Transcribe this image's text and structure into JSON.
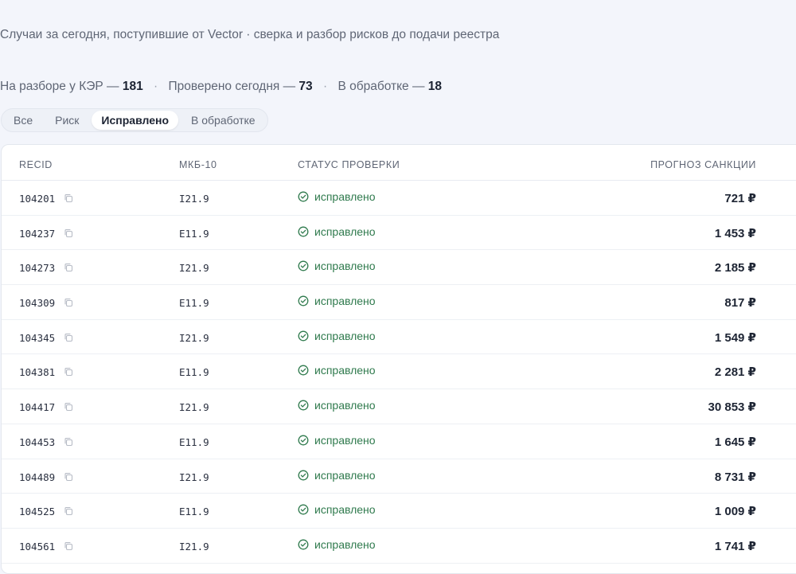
{
  "header": {
    "subtitle": "Случаи за сегодня, поступившие от Vector · сверка и разбор рисков до подачи реестра"
  },
  "stats": [
    {
      "label": "На разборе у КЭР —",
      "value": "181"
    },
    {
      "label": "Проверено сегодня —",
      "value": "73"
    },
    {
      "label": "В обработке —",
      "value": "18"
    }
  ],
  "stats_separator": "·",
  "tabs": [
    {
      "label": "Все"
    },
    {
      "label": "Риск"
    },
    {
      "label": "Исправлено"
    },
    {
      "label": "В обработке"
    }
  ],
  "active_tab": "Исправлено",
  "table": {
    "columns": {
      "recid": "RECID",
      "mkb": "МКБ-10",
      "status": "СТАТУС ПРОВЕРКИ",
      "sanction": "ПРОГНОЗ САНКЦИИ"
    },
    "rows": [
      {
        "recid": "104201",
        "mkb": "I21.9",
        "status": "исправлено",
        "sanction": "721 ₽"
      },
      {
        "recid": "104237",
        "mkb": "E11.9",
        "status": "исправлено",
        "sanction": "1 453 ₽"
      },
      {
        "recid": "104273",
        "mkb": "I21.9",
        "status": "исправлено",
        "sanction": "2 185 ₽"
      },
      {
        "recid": "104309",
        "mkb": "E11.9",
        "status": "исправлено",
        "sanction": "817 ₽"
      },
      {
        "recid": "104345",
        "mkb": "I21.9",
        "status": "исправлено",
        "sanction": "1 549 ₽"
      },
      {
        "recid": "104381",
        "mkb": "E11.9",
        "status": "исправлено",
        "sanction": "2 281 ₽"
      },
      {
        "recid": "104417",
        "mkb": "I21.9",
        "status": "исправлено",
        "sanction": "30 853 ₽"
      },
      {
        "recid": "104453",
        "mkb": "E11.9",
        "status": "исправлено",
        "sanction": "1 645 ₽"
      },
      {
        "recid": "104489",
        "mkb": "I21.9",
        "status": "исправлено",
        "sanction": "8 731 ₽"
      },
      {
        "recid": "104525",
        "mkb": "E11.9",
        "status": "исправлено",
        "sanction": "1 009 ₽"
      },
      {
        "recid": "104561",
        "mkb": "I21.9",
        "status": "исправлено",
        "sanction": "1 741 ₽"
      }
    ]
  },
  "icons": {
    "copy": "copy-icon",
    "status_ok": "check-circle-icon"
  },
  "colors": {
    "status_ok": "#2f7a4d",
    "background": "#f3f5fb"
  }
}
